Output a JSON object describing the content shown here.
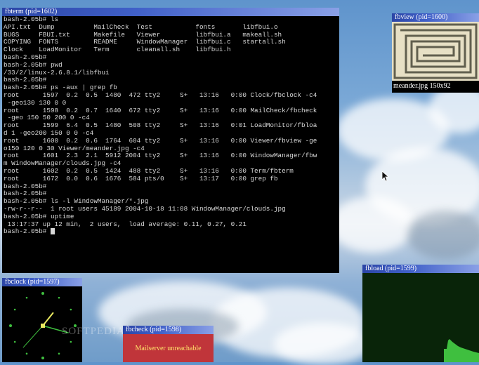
{
  "windows": {
    "fbterm": {
      "title": "fbterm (pid=1602)",
      "lines": [
        "bash-2.05b# ls",
        "API.txt  Dump          MailCheck  Test           fonts       libfbui.o",
        "BUGS     FBUI.txt      Makefile   Viewer         libfbui.a   makeall.sh",
        "COPYING  FONTS         README     WindowManager  libfbui.c   startall.sh",
        "Clock    LoadMonitor   Term       cleanall.sh    libfbui.h",
        "bash-2.05b#",
        "bash-2.05b# pwd",
        "/33/2/linux-2.6.8.1/libfbui",
        "bash-2.05b#",
        "bash-2.05b# ps -aux | grep fb",
        "root      1597  0.2  0.5  1480  472 tty2     S+   13:16   0:00 Clock/fbclock -c4",
        " -geo130 130 0 0",
        "root      1598  0.2  0.7  1640  672 tty2     S+   13:16   0:00 MailCheck/fbcheck",
        " -geo 150 50 200 0 -c4",
        "root      1599  6.4  0.5  1480  508 tty2     S+   13:16   0:01 LoadMonitor/fbloa",
        "d 1 -geo200 150 0 0 -c4",
        "root      1600  0.2  0.6  1764  604 tty2     S+   13:16   0:00 Viewer/fbview -ge",
        "o150 120 0 30 Viewer/meander.jpg -c4",
        "root      1601  2.3  2.1  5912 2004 tty2     S+   13:16   0:00 WindowManager/fbw",
        "m WindowManager/clouds.jpg -c4",
        "root      1602  0.2  0.5  1424  488 tty2     S+   13:16   0:00 Term/fbterm",
        "root      1672  0.0  0.6  1676  584 pts/0    S+   13:17   0:00 grep fb",
        "bash-2.05b#",
        "bash-2.05b#",
        "bash-2.05b# ls -l WindowManager/*.jpg",
        "-rw-r--r--  1 root users 45189 2004-10-18 11:08 WindowManager/clouds.jpg",
        "bash-2.05b# uptime",
        " 13:17:37 up 12 min,  2 users,  load average: 0.11, 0.27, 0.21"
      ],
      "prompt": "bash-2.05b# "
    },
    "fbview": {
      "title": "fbview (pid=1600)",
      "caption": "meander.jpg 150x92"
    },
    "fbclock": {
      "title": "fbclock (pid=1597)",
      "hour": 1,
      "minute": 17,
      "second": 37
    },
    "fbcheck": {
      "title": "fbcheck (pid=1598)",
      "message": "Mailserver unreachable"
    },
    "fbload": {
      "title": "fbload (pid=1599)"
    }
  },
  "watermark": "SOFTPEDIA",
  "colors": {
    "titlebar": "#2b45a6",
    "terminal_bg": "#000000",
    "terminal_fg": "#d8d8d8",
    "clock_face": "#3fbf3f",
    "clock_hands": "#e8e860",
    "mail_bg": "#c0353a",
    "mail_text": "#ffe26a",
    "load_graph": "#3fbf3f"
  }
}
